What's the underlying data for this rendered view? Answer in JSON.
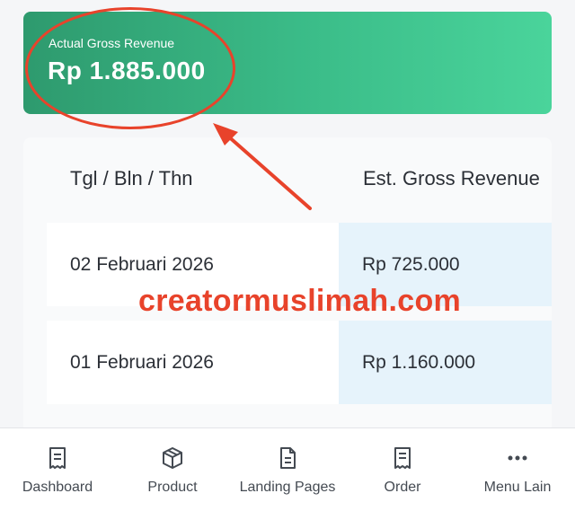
{
  "revenue_card": {
    "label": "Actual Gross Revenue",
    "value": "Rp 1.885.000"
  },
  "table": {
    "headers": [
      "Tgl / Bln / Thn",
      "Est. Gross Revenue"
    ],
    "rows": [
      {
        "date": "02 Februari 2026",
        "revenue": "Rp 725.000"
      },
      {
        "date": "01 Februari 2026",
        "revenue": "Rp 1.160.000"
      }
    ]
  },
  "watermark": "creatormuslimah.com",
  "bottom_nav": [
    {
      "label": "Dashboard",
      "icon": "receipt-icon"
    },
    {
      "label": "Product",
      "icon": "box-icon"
    },
    {
      "label": "Landing Pages",
      "icon": "document-icon"
    },
    {
      "label": "Order",
      "icon": "order-receipt-icon"
    },
    {
      "label": "Menu Lain",
      "icon": "more-dots-icon"
    }
  ],
  "colors": {
    "card_gradient_start": "#2e9a6e",
    "card_gradient_end": "#4ad49b",
    "annotation_red": "#e8432b",
    "revenue_cell_bg": "#e6f3fb"
  }
}
